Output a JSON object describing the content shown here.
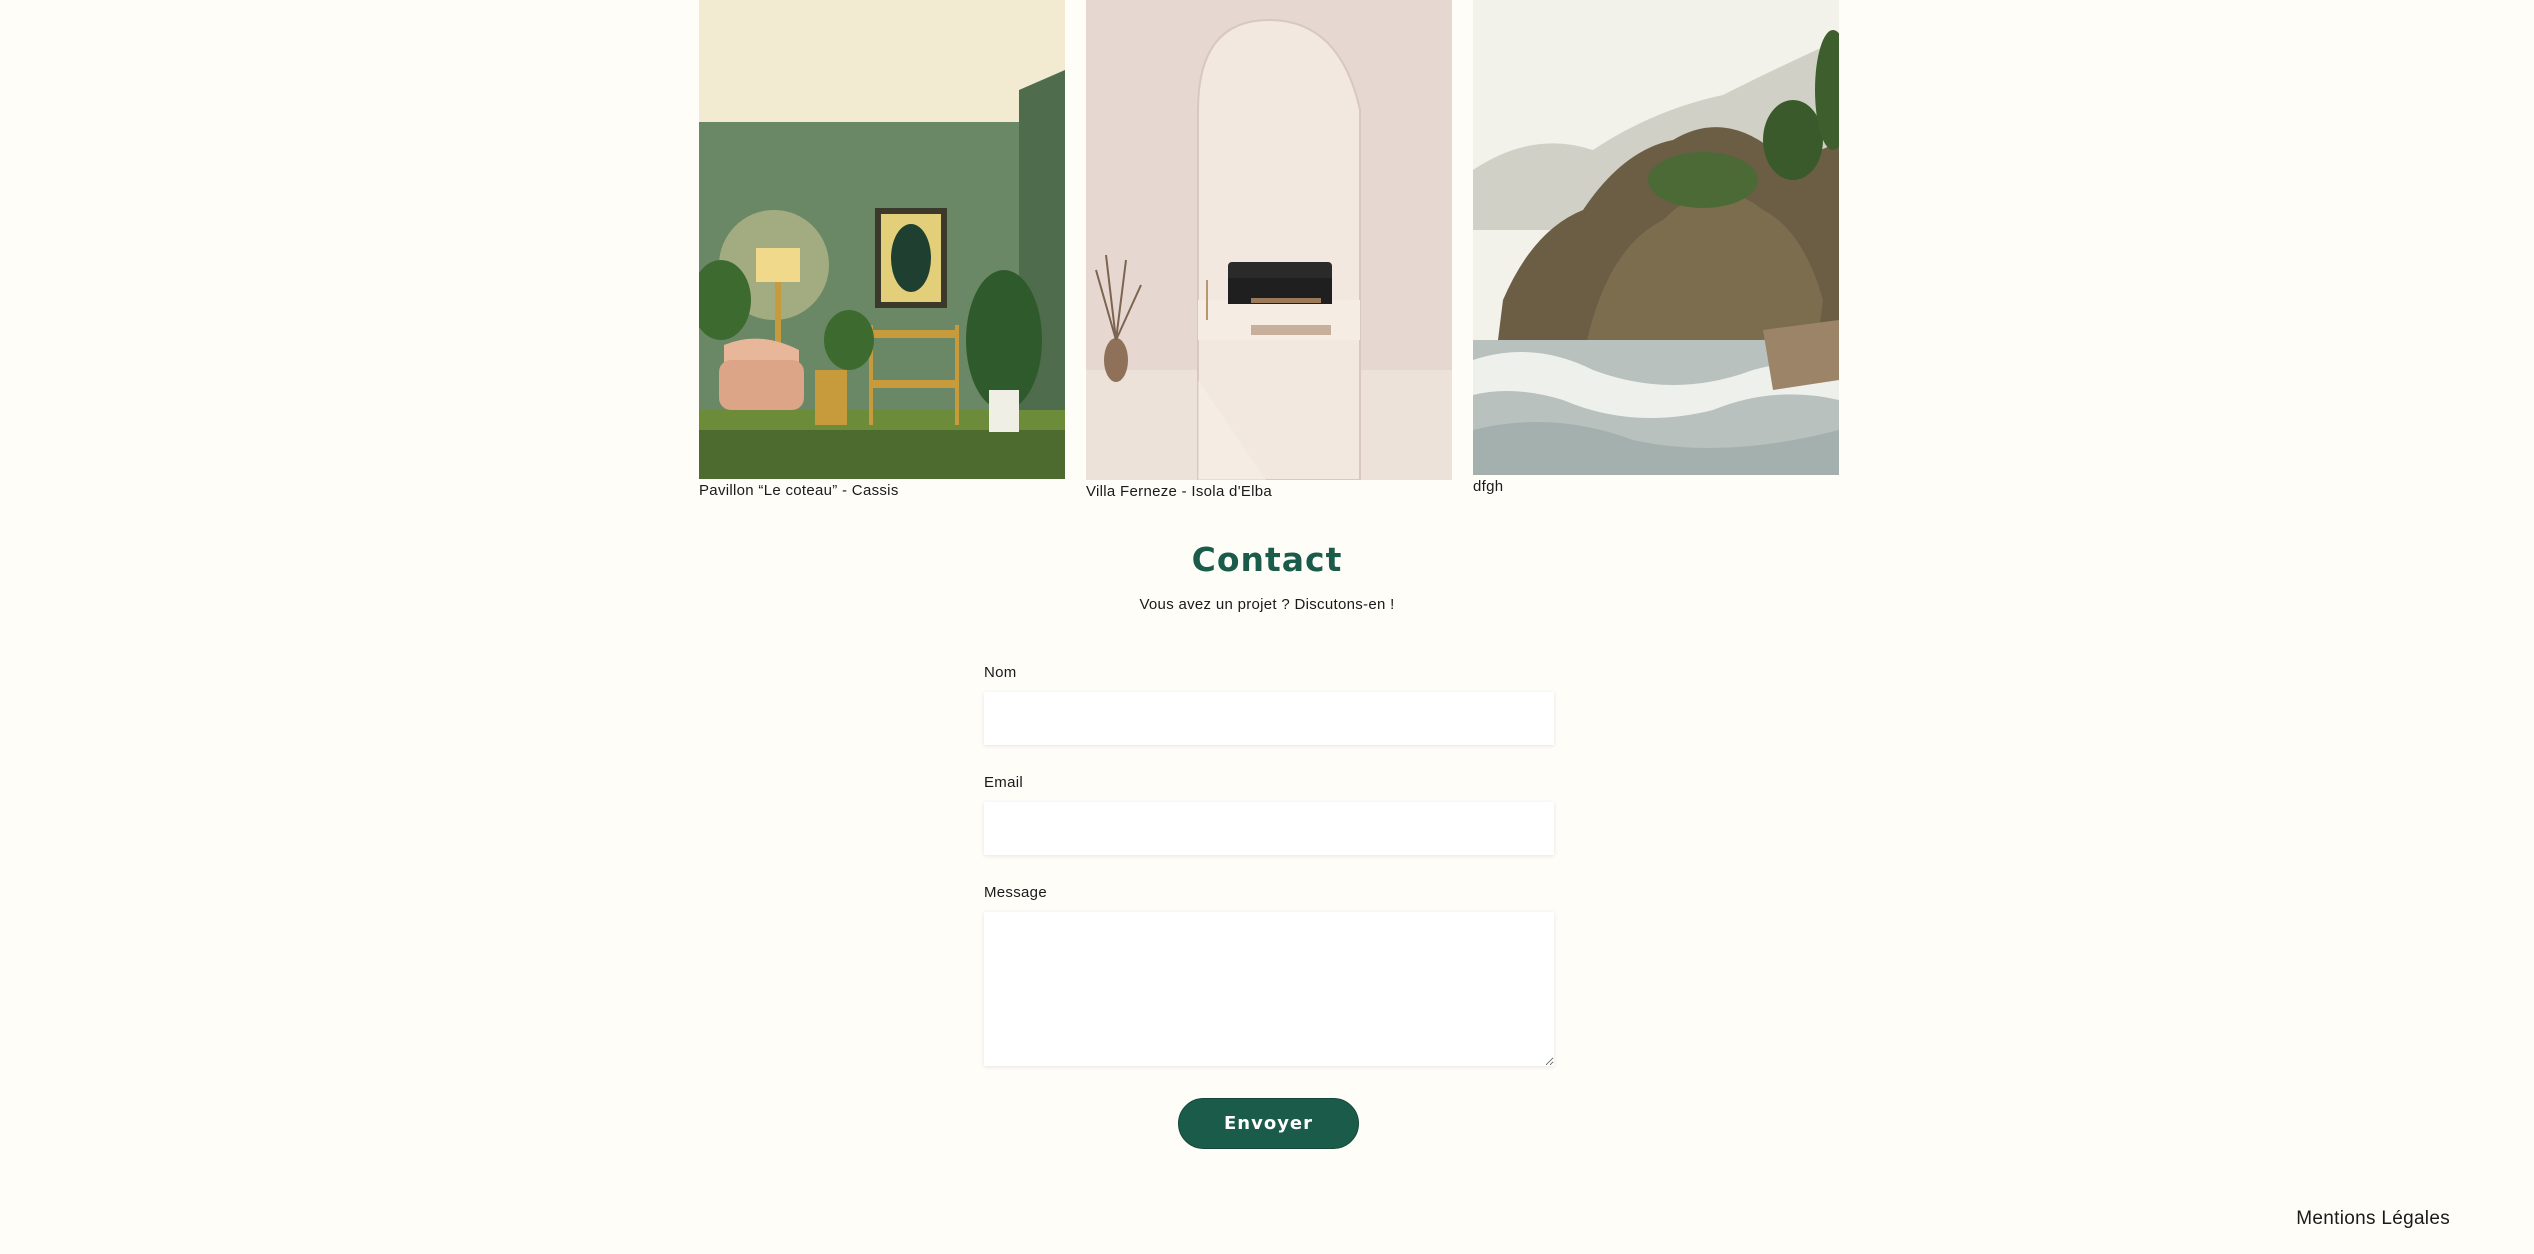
{
  "gallery": {
    "items": [
      {
        "caption": "Pavillon “Le coteau” - Cassis",
        "image": "green-living-room-photo"
      },
      {
        "caption": "Villa Ferneze - Isola d'Elba",
        "image": "arched-hallway-photo"
      },
      {
        "caption": "dfgh",
        "image": "coastal-rocks-photo"
      }
    ]
  },
  "contact": {
    "title": "Contact",
    "subtitle": "Vous avez un projet ? Discutons-en !",
    "fields": {
      "name_label": "Nom",
      "email_label": "Email",
      "message_label": "Message",
      "name_value": "",
      "email_value": "",
      "message_value": ""
    },
    "submit_label": "Envoyer"
  },
  "footer": {
    "legal_link": "Mentions Légales"
  },
  "colors": {
    "background": "#fefdf8",
    "accent": "#1b5b49"
  }
}
